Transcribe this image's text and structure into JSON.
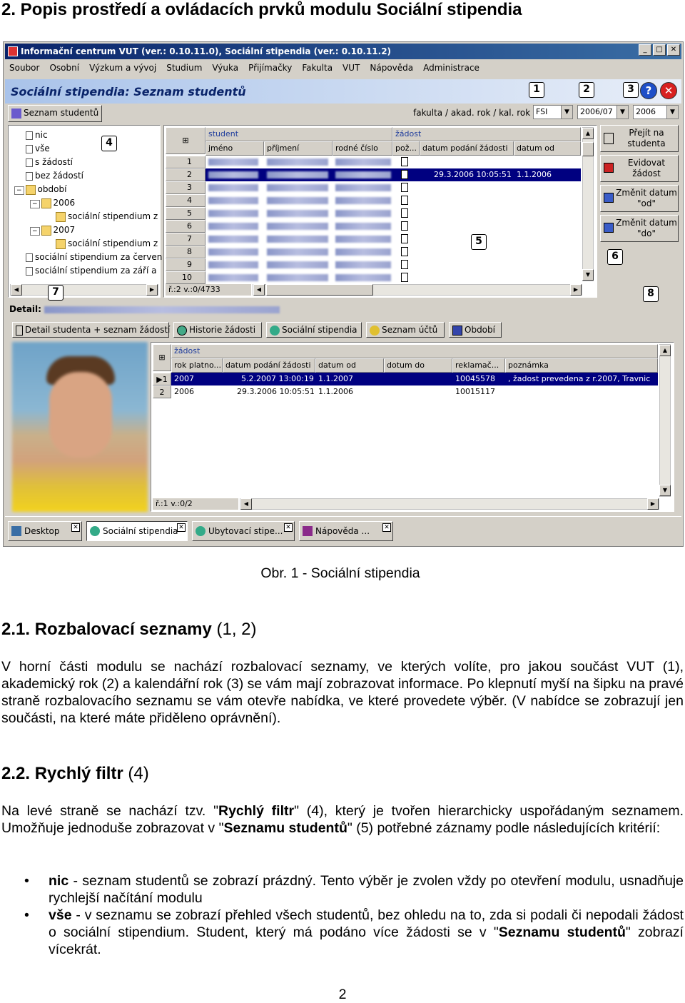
{
  "doc": {
    "heading": "2. Popis prostředí a ovládacích prvků modulu Sociální stipendia",
    "caption": "Obr. 1 - Sociální stipendia",
    "s1_num": "2.1.",
    "s1_title": "Rozbalovací seznamy",
    "s1_ref": "(1, 2)",
    "s1_p1": "V horní části modulu se nachází rozbalovací seznamy, ve kterých volíte, pro jakou součást VUT (1), akademický rok (2) a kalendářní rok (3) se vám mají zobrazovat informace. Po klepnutí myší na šipku na pravé straně rozbalovacího seznamu se vám otevře nabídka, ve které provedete výběr. (V nabídce se zobrazují jen součásti, na které máte přiděleno oprávnění).",
    "s2_num": "2.2.",
    "s2_title": "Rychlý filtr",
    "s2_ref": "(4)",
    "s2_p1a": "Na levé straně se nachází tzv. \"",
    "s2_p1b": "Rychlý filtr",
    "s2_p1c": "\" (4), který je tvořen hierarchicky uspořádaným seznamem. Umožňuje jednoduše zobrazovat v \"",
    "s2_p1d": "Seznamu studentů",
    "s2_p1e": "\" (5) potřebné záznamy podle následujících kritérií:",
    "b1_key": "nic",
    "b1_text": " - seznam studentů se zobrazí prázdný. Tento výběr je zvolen vždy po otevření modulu, usnadňuje rychlejší načítání modulu",
    "b2_key": "vše",
    "b2_text1": " - v seznamu se zobrazí přehled všech studentů, bez ohledu na to, zda si podali či nepodali žádost o sociální stipendium. Student, který má podáno více žádosti se v \"",
    "b2_bold": "Seznamu studentů",
    "b2_text2": "\" zobrazí vícekrát.",
    "page_number": "2"
  },
  "app": {
    "window_title": "Informační centrum VUT (ver.: 0.10.11.0), Sociální stipendia (ver.: 0.10.11.2)",
    "menu": [
      "Soubor",
      "Osobní",
      "Výzkum a vývoj",
      "Studium",
      "Výuka",
      "Přijímačky",
      "Fakulta",
      "VUT",
      "Nápověda",
      "Administrace"
    ],
    "header_title": "Sociální stipendia: Seznam studentů",
    "list_tab": "Seznam studentů",
    "filter_label": "fakulta / akad. rok / kal. rok",
    "combo_faculty": "FSI",
    "combo_acad_year": "2006/07",
    "combo_cal_year": "2006",
    "callouts": [
      "1",
      "2",
      "3",
      "4",
      "5",
      "6",
      "7",
      "8"
    ],
    "tree": [
      "nic",
      "vše",
      "s žádostí",
      "bez žádostí",
      "období",
      "2006",
      "sociální stipendium z",
      "2007",
      "sociální stipendium z",
      "sociální stipendium za červen",
      "sociální stipendium za září a"
    ],
    "grid_groups": {
      "student": "student",
      "zadost": "žádost"
    },
    "grid_cols": [
      "jméno",
      "příjmení",
      "rodné číslo",
      "pož...",
      "datum podání žádosti",
      "datum od"
    ],
    "grid_rows": [
      "1",
      "2",
      "3",
      "4",
      "5",
      "6",
      "7",
      "8",
      "9",
      "10"
    ],
    "grid_selected": {
      "date": "29.3.2006 10:05:51",
      "from": "1.1.2006"
    },
    "grid_status": "ř.:2 v.:0/4733",
    "side_buttons": [
      {
        "line1": "Přejít na",
        "line2": "studenta"
      },
      {
        "line1": "Evidovat",
        "line2": "žádost"
      },
      {
        "line1": "Změnit datum",
        "line2": "\"od\""
      },
      {
        "line1": "Změnit datum",
        "line2": "\"do\""
      }
    ],
    "detail_label": "Detail:",
    "detail_tabs": [
      "Detail studenta + seznam žádostí",
      "Historie žádosti",
      "Sociální stipendia",
      "Seznam účtů",
      "Období"
    ],
    "dgrid_group": "žádost",
    "dgrid_cols": [
      "rok platno...",
      "datum podání žádosti",
      "datum od",
      "dotum do",
      "reklamač...",
      "poznámka"
    ],
    "dgrid_rows": [
      {
        "n": "1",
        "year": "2007",
        "date": "5.2.2007 13:00:19",
        "from": "1.1.2007",
        "rekl": "10045578",
        "note": ", žadost prevedena z r.2007, Travnic"
      },
      {
        "n": "2",
        "year": "2006",
        "date": "29.3.2006 10:05:51",
        "from": "1.1.2006",
        "rekl": "10015117",
        "note": ""
      }
    ],
    "dgrid_status": "ř.:1 v.:0/2",
    "taskbar": [
      "Desktop",
      "Sociální stipendia",
      "Ubytovací stipe...",
      "Nápověda ..."
    ]
  }
}
